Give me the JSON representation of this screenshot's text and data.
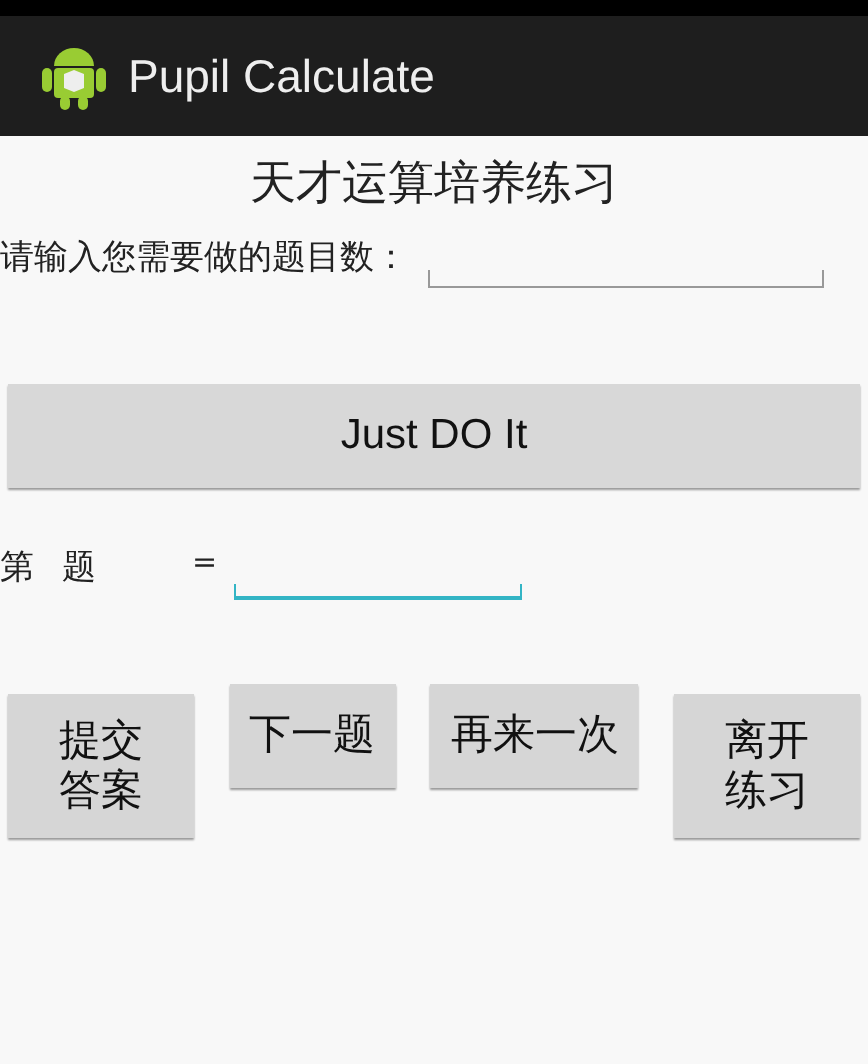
{
  "action_bar": {
    "title": "Pupil Calculate"
  },
  "heading": "天才运算培养练习",
  "count_prompt": {
    "label": "请输入您需要做的题目数：",
    "focused": false
  },
  "start_button": "Just DO It",
  "question": {
    "prefix": "第",
    "suffix": "题",
    "equals": "=",
    "focused": true
  },
  "buttons": [
    {
      "label": "提交答案",
      "kind": "tall"
    },
    {
      "label": "下一题",
      "kind": "short"
    },
    {
      "label": "再来一次",
      "kind": "short"
    },
    {
      "label": "离开练习",
      "kind": "tall"
    }
  ]
}
